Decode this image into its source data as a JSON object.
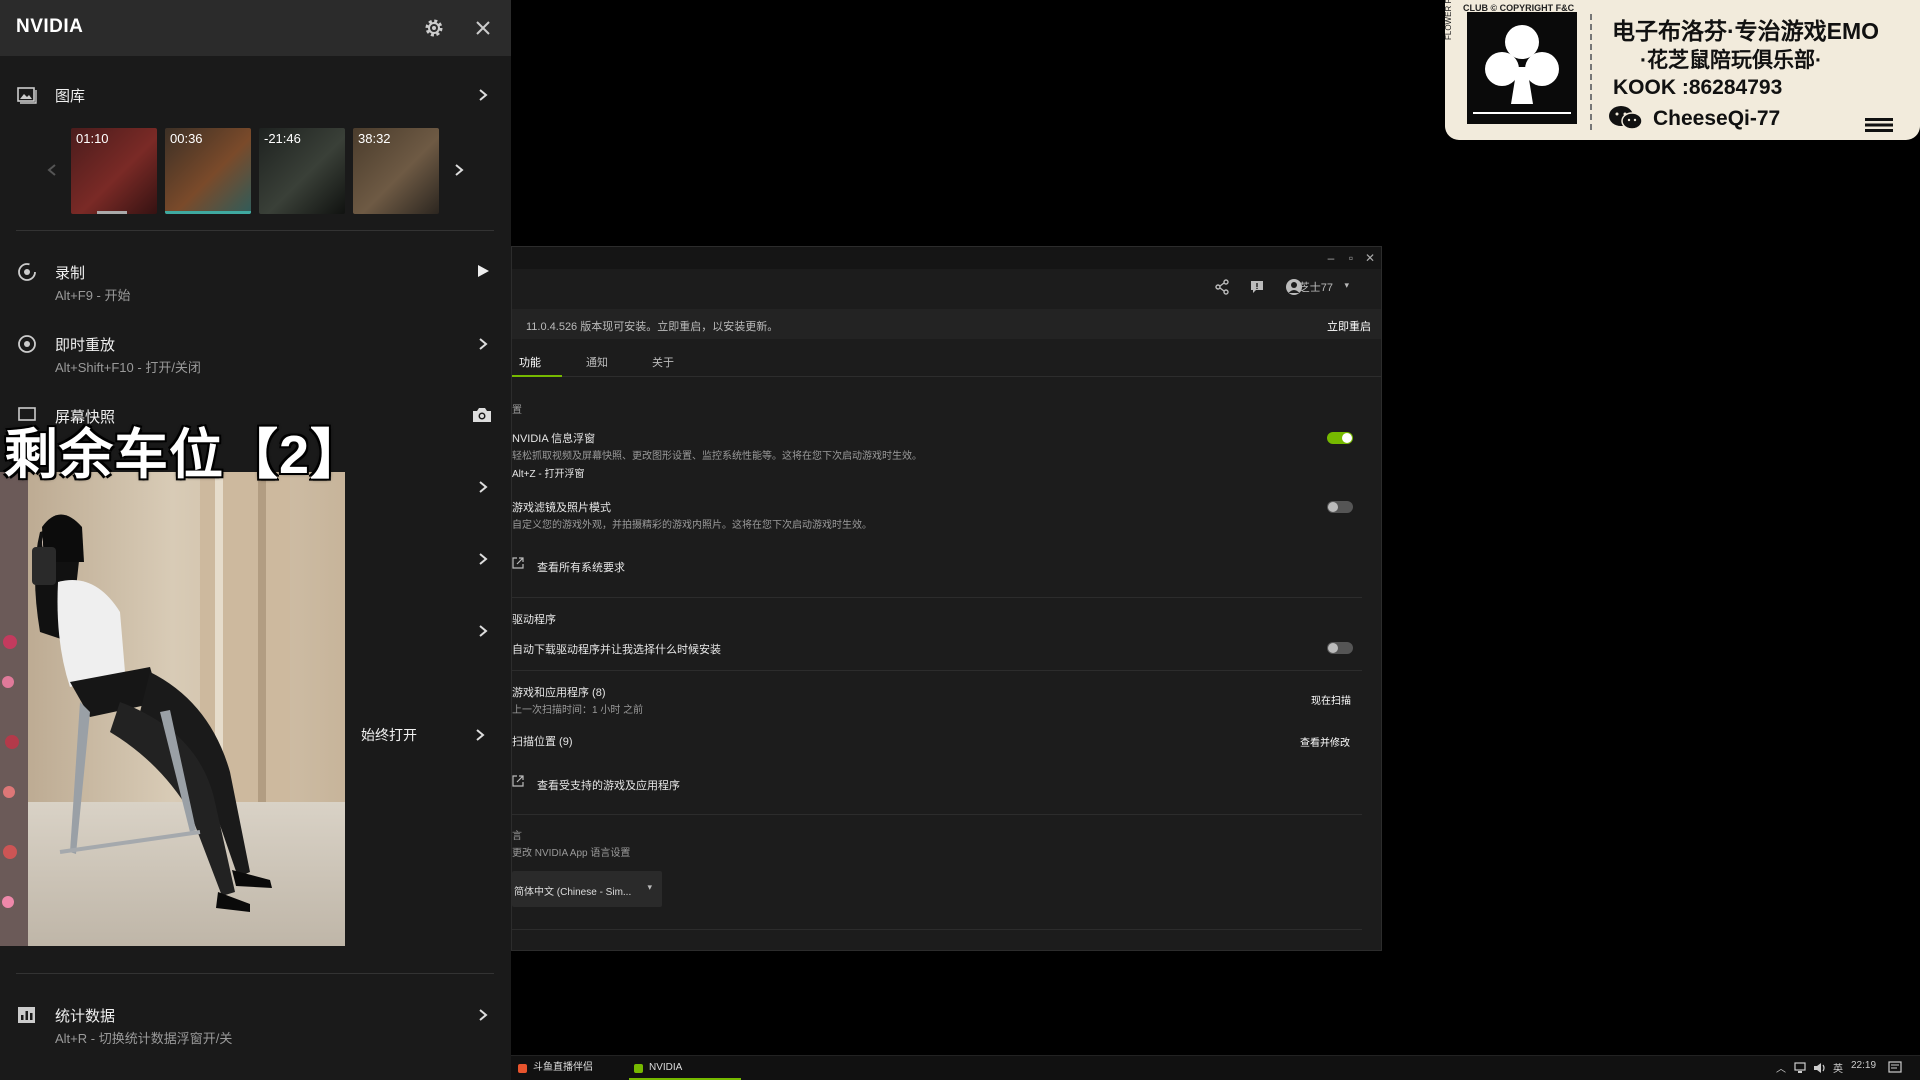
{
  "overlay": {
    "brand": "NVIDIA",
    "gallery": {
      "label": "图库",
      "thumbs": [
        {
          "time": "01:10",
          "colors": [
            "#4a1c1c",
            "#7a2a26",
            "#351212"
          ],
          "bar": "#aaaaaa"
        },
        {
          "time": "00:36",
          "colors": [
            "#3c3026",
            "#7a4a2a",
            "#2f5c5a"
          ],
          "bar": "#3fa9a0"
        },
        {
          "time": "-21:46",
          "colors": [
            "#1e2220",
            "#3a4038",
            "#101210"
          ],
          "bar": "#555555"
        },
        {
          "time": "38:32",
          "colors": [
            "#4a3c2c",
            "#6e5a44",
            "#2c2620"
          ],
          "bar": "#555555"
        }
      ]
    },
    "record": {
      "label": "录制",
      "shortcut": "Alt+F9 - 开始"
    },
    "instant_replay": {
      "label": "即时重放",
      "shortcut": "Alt+Shift+F10 - 打开/关闭"
    },
    "screenshot": {
      "label": "屏幕快照"
    },
    "always_open": "始终打开",
    "stats": {
      "label": "统计数据",
      "shortcut": "Alt+R - 切换统计数据浮窗开/关"
    }
  },
  "banner": "剩余车位【2】",
  "settings": {
    "user": "芝士77",
    "update_msg": "11.0.4.526 版本现可安装。立即重启，以安装更新。",
    "update_action": "立即重启",
    "tabs": [
      "功能",
      "通知",
      "关于"
    ],
    "section_overlay_head": "置",
    "overlay_title": "NVIDIA 信息浮窗",
    "overlay_desc": "轻松抓取视频及屏幕快照、更改图形设置、监控系统性能等。这将在您下次启动游戏时生效。",
    "overlay_shortcut": "Alt+Z - 打开浮窗",
    "filter_title": "游戏滤镜及照片模式",
    "filter_desc": "自定义您的游戏外观，并拍摄精彩的游戏内照片。这将在您下次启动游戏时生效。",
    "sysreq_link": "查看所有系统要求",
    "driver_head": "驱动程序",
    "driver_auto": "自动下载驱动程序并让我选择什么时候安装",
    "games_title": "游戏和应用程序 (8)",
    "games_last": "上一次扫描时间：1 小时 之前",
    "scan_now": "现在扫描",
    "scan_loc": "扫描位置 (9)",
    "view_modify": "查看并修改",
    "supported_link": "查看受支持的游戏及应用程序",
    "lang_head": "言",
    "lang_desc": "更改 NVIDIA App 语言设置",
    "lang_value": "简体中文 (Chinese - Sim..."
  },
  "promo": {
    "copyright": "CLUB © COPYRIGHT F&C",
    "vertical": "FLOWER RAT PLAY",
    "line1": "电子布洛芬·专治游戏EMO",
    "line2": "·花芝鼠陪玩俱乐部·",
    "line3": "KOOK :86284793",
    "line4": "CheeseQi-77"
  },
  "taskbar": {
    "items": [
      "斗鱼直播伴侣",
      "NVIDIA"
    ],
    "lang": "英",
    "time": "22:19"
  }
}
